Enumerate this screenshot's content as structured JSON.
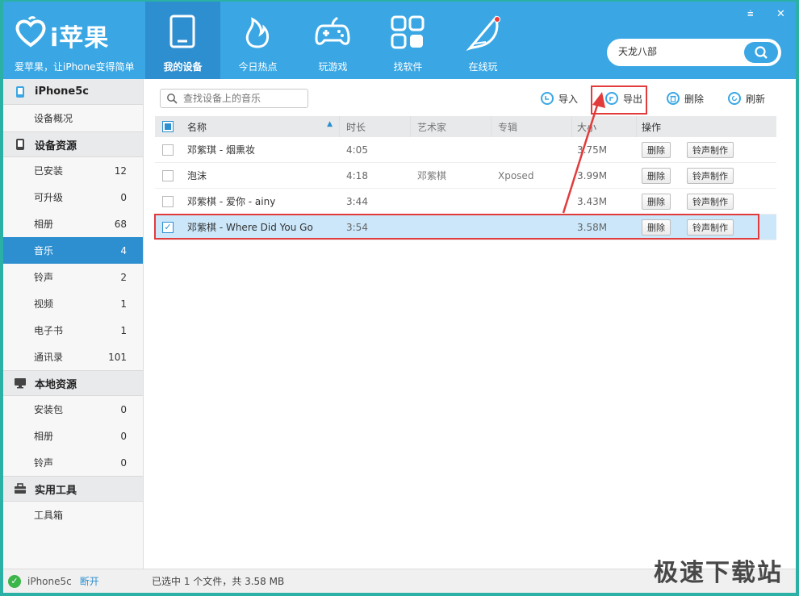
{
  "app": {
    "logo_text": "i苹果",
    "tagline": "爱苹果，让iPhone变得简单",
    "nav": [
      {
        "label": "我的设备",
        "icon": "tablet-icon",
        "active": true
      },
      {
        "label": "今日热点",
        "icon": "flame-icon"
      },
      {
        "label": "玩游戏",
        "icon": "gamepad-icon"
      },
      {
        "label": "找软件",
        "icon": "apps-grid-icon"
      },
      {
        "label": "在线玩",
        "icon": "feather-icon",
        "badge": true
      }
    ],
    "search_value": "天龙八部",
    "window_controls": {
      "menu": "⩧",
      "close": "✕"
    }
  },
  "sidebar": {
    "device": "iPhone5c",
    "device_overview": "设备概况",
    "device_resources": {
      "title": "设备资源",
      "items": [
        {
          "label": "已安装",
          "count": "12"
        },
        {
          "label": "可升级",
          "count": "0"
        },
        {
          "label": "相册",
          "count": "68"
        },
        {
          "label": "音乐",
          "count": "4"
        },
        {
          "label": "铃声",
          "count": "2"
        },
        {
          "label": "视频",
          "count": "1"
        },
        {
          "label": "电子书",
          "count": "1"
        },
        {
          "label": "通讯录",
          "count": "101"
        }
      ]
    },
    "local_resources": {
      "title": "本地资源",
      "items": [
        {
          "label": "安装包",
          "count": "0"
        },
        {
          "label": "相册",
          "count": "0"
        },
        {
          "label": "铃声",
          "count": "0"
        }
      ]
    },
    "tools": {
      "title": "实用工具",
      "items": [
        {
          "label": "工具箱"
        }
      ]
    },
    "status": {
      "device": "iPhone5c",
      "action": "断开"
    }
  },
  "toolbar": {
    "search_placeholder": "查找设备上的音乐",
    "import": "导入",
    "export": "导出",
    "delete": "删除",
    "refresh": "刷新"
  },
  "table": {
    "headers": {
      "name": "名称",
      "duration": "时长",
      "artist": "艺术家",
      "album": "专辑",
      "size": "大小",
      "ops": "操作"
    },
    "rows": [
      {
        "name": "邓紫琪 - 烟熏妆",
        "duration": "4:05",
        "artist": "",
        "album": "",
        "size": "3.75M",
        "selected": false
      },
      {
        "name": "泡沫",
        "duration": "4:18",
        "artist": "邓紫棋",
        "album": "Xposed",
        "size": "3.99M",
        "selected": false
      },
      {
        "name": "邓紫棋 - 爱你 - ainy",
        "duration": "3:44",
        "artist": "",
        "album": "",
        "size": "3.43M",
        "selected": false
      },
      {
        "name": "邓紫棋 - Where Did You Go",
        "duration": "3:54",
        "artist": "",
        "album": "",
        "size": "3.58M",
        "selected": true
      }
    ],
    "op_delete": "删除",
    "op_ringtone": "铃声制作"
  },
  "status_bar": "已选中 1 个文件，共 3.58 MB",
  "watermark": "极速下载站",
  "colors": {
    "header": "#3aa7e4",
    "active": "#2d8fd0",
    "selected_row": "#cbe7f9",
    "annotation": "#e23b3b"
  }
}
